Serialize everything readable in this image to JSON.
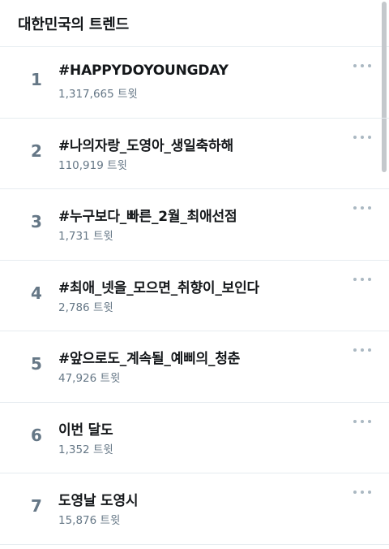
{
  "header": {
    "title": "대한민국의 트렌드"
  },
  "colors": {
    "text_primary": "#14171a",
    "text_secondary": "#657786",
    "divider": "#e6ecf0",
    "more_dots": "#aab8c2"
  },
  "trends": [
    {
      "rank": "1",
      "name": "#HAPPYDOYOUNGDAY",
      "count": "1,317,665 트윗"
    },
    {
      "rank": "2",
      "name": "#나의자랑_도영아_생일축하해",
      "count": "110,919 트윗"
    },
    {
      "rank": "3",
      "name": "#누구보다_빠른_2월_최애선점",
      "count": "1,731 트윗"
    },
    {
      "rank": "4",
      "name": "#최애_넷을_모으면_취향이_보인다",
      "count": "2,786 트윗"
    },
    {
      "rank": "5",
      "name": "#앞으로도_계속될_예삐의_청춘",
      "count": "47,926 트윗"
    },
    {
      "rank": "6",
      "name": "이번 달도",
      "count": "1,352 트윗"
    },
    {
      "rank": "7",
      "name": "도영날 도영시",
      "count": "15,876 트윗"
    }
  ],
  "icons": {
    "more": "more-horizontal-icon"
  }
}
